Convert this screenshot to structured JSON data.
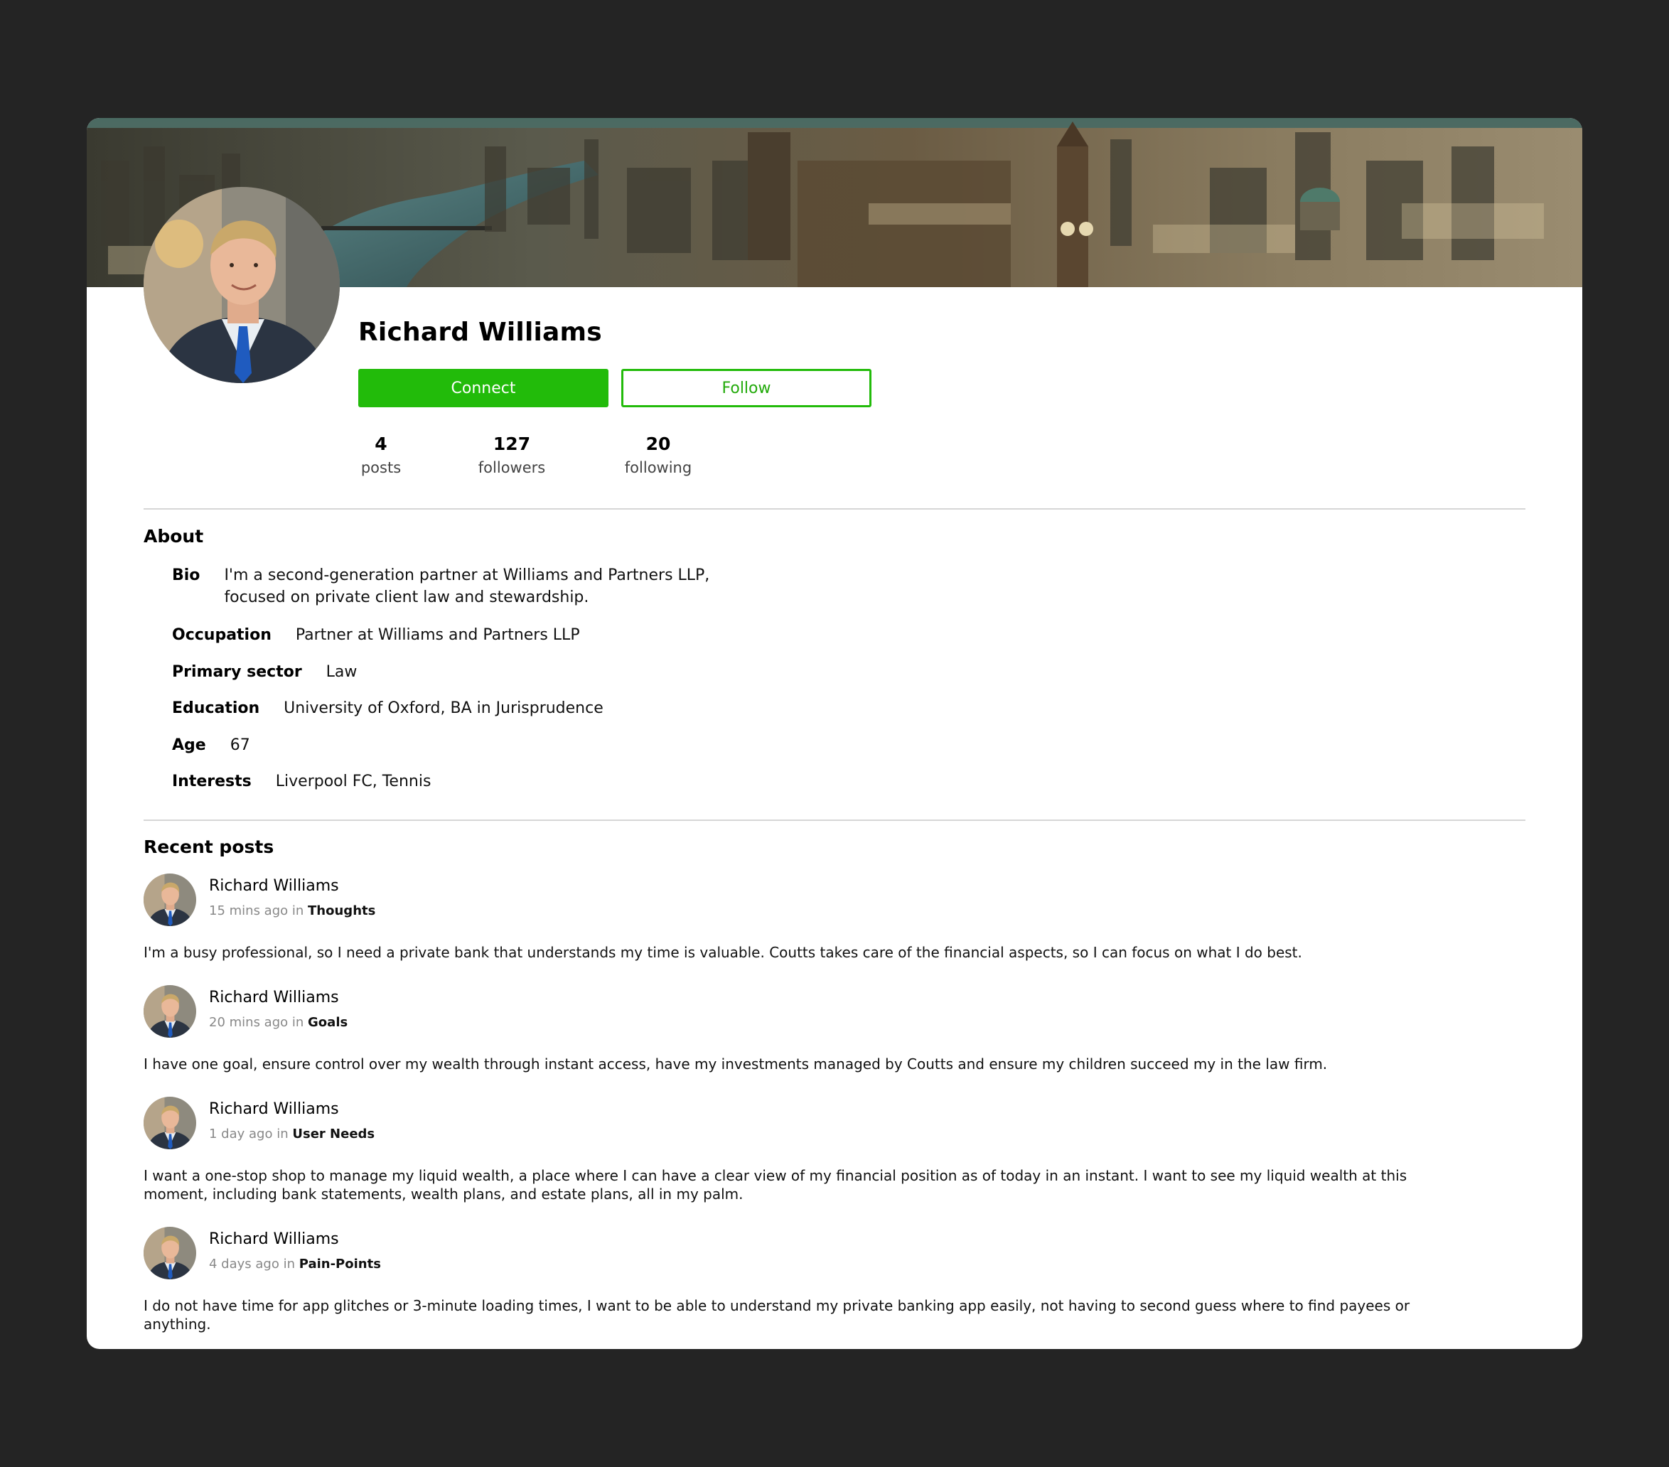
{
  "profile": {
    "name": "Richard Williams",
    "connect_label": "Connect",
    "follow_label": "Follow",
    "stats": [
      {
        "value": "4",
        "label": "posts"
      },
      {
        "value": "127",
        "label": "followers"
      },
      {
        "value": "20",
        "label": "following"
      }
    ]
  },
  "about": {
    "title": "About",
    "bio_label": "Bio",
    "bio_line1": "I'm a second-generation partner at Williams and Partners LLP,",
    "bio_line2": "focused on private client law and stewardship.",
    "occupation_label": "Occupation",
    "occupation": "Partner at Williams and Partners LLP",
    "sector_label": "Primary sector",
    "sector": "Law",
    "education_label": "Education",
    "education": "University of Oxford, BA in Jurisprudence",
    "age_label": "Age",
    "age": "67",
    "interests_label": "Interests",
    "interests": "Liverpool FC, Tennis"
  },
  "recent": {
    "title": "Recent posts",
    "posts": [
      {
        "author": "Richard Williams",
        "time": "15 mins ago",
        "in": "in",
        "category": "Thoughts",
        "text": "I'm a busy professional, so I need a private bank that understands my time is valuable. Coutts takes care of the financial aspects, so I can focus on what I do best."
      },
      {
        "author": "Richard Williams",
        "time": "20 mins ago",
        "in": "in",
        "category": "Goals",
        "text": "I have one goal, ensure control over my wealth through instant access, have my investments managed by Coutts and ensure my children succeed my in the law firm."
      },
      {
        "author": "Richard Williams",
        "time": "1 day ago",
        "in": "in",
        "category": "User Needs",
        "text": "I want a one-stop shop to manage my liquid wealth, a place where I can have a clear view of my financial position as of today in an instant. I want to see my liquid wealth at this moment, including bank statements, wealth plans, and estate plans, all in my palm."
      },
      {
        "author": "Richard Williams",
        "time": "4 days ago",
        "in": "in",
        "category": "Pain-Points",
        "text": "I do not have time for app glitches or 3-minute loading times, I want to be able to understand my private banking app easily, not having to second guess where to find payees or anything."
      }
    ]
  },
  "colors": {
    "accent": "#22bb0a",
    "background": "#242424",
    "card": "#ffffff"
  },
  "icons": {
    "cover": "london-skyline-cover-image",
    "avatar": "user-avatar-photo"
  }
}
